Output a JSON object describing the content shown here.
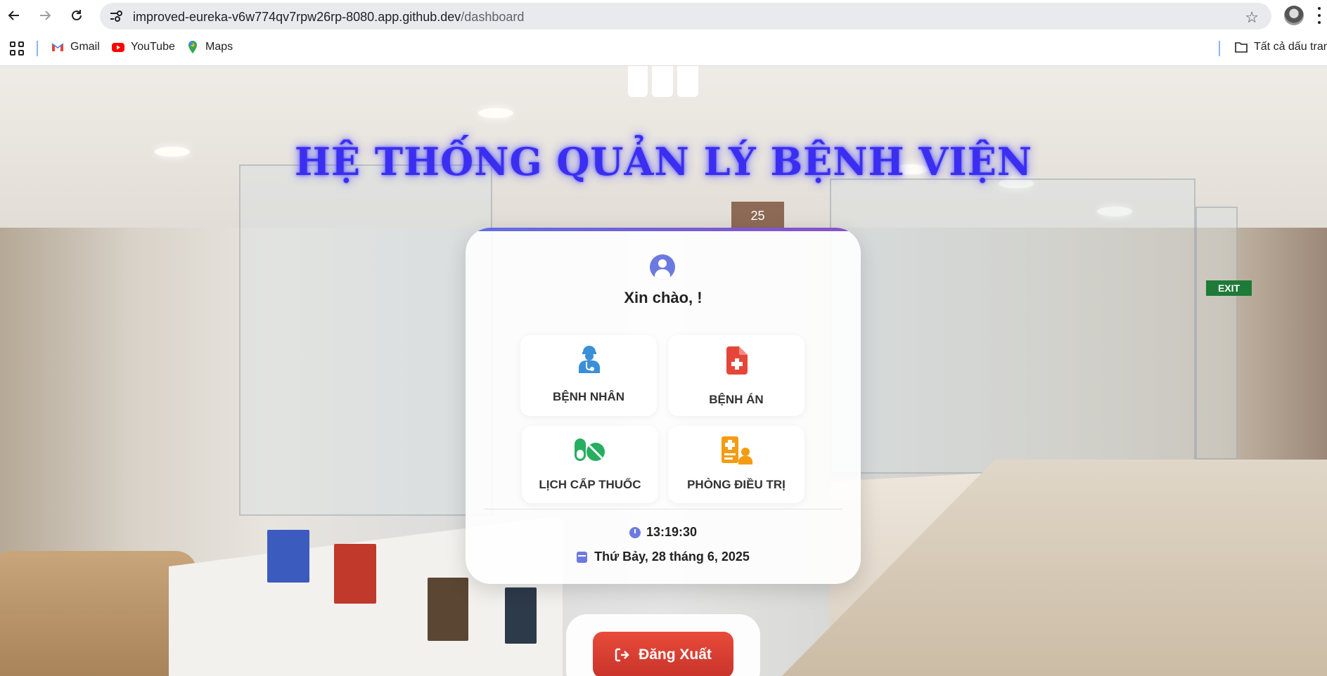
{
  "browser": {
    "url_host": "improved-eureka-v6w774qv7rpw26rp-8080.app.github.dev",
    "url_path": "/dashboard",
    "bookmarks": [
      {
        "label": "Gmail",
        "icon": "gmail-icon"
      },
      {
        "label": "YouTube",
        "icon": "youtube-icon"
      },
      {
        "label": "Maps",
        "icon": "maps-icon"
      }
    ],
    "all_bookmarks_label": "Tất cả dấu trang"
  },
  "page": {
    "headline": "HỆ THỐNG QUẢN LÝ BỆNH VIỆN",
    "greeting": "Xin chào, !",
    "tiles": [
      {
        "label": "BỆNH NHÂN",
        "icon": "patient-icon",
        "color": "#3a8fd8"
      },
      {
        "label": "BỆNH ÁN",
        "icon": "medical-record-icon",
        "color": "#e5463a"
      },
      {
        "label": "LỊCH CẤP THUỐC",
        "icon": "pills-icon",
        "color": "#27ae60"
      },
      {
        "label": "PHÒNG ĐIỀU TRỊ",
        "icon": "treatment-room-icon",
        "color": "#f39c12"
      }
    ],
    "time": "13:19:30",
    "date": "Thứ Bảy, 28 tháng 6, 2025",
    "logout_label": "Đăng Xuất"
  },
  "background": {
    "room_number": "25",
    "exit_sign": "EXIT"
  },
  "colors": {
    "accent": "#6c7ae0",
    "headline": "#3b2ef0",
    "logout": "#d63a2f"
  }
}
